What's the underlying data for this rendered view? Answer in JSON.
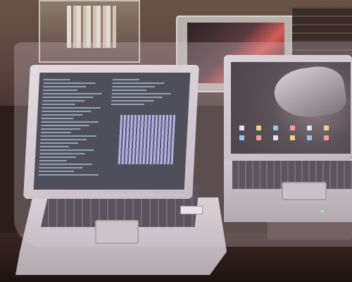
{
  "scene": {
    "subject": "",
    "colors": {
      "terminal_text": "#9fb5c6",
      "bars": "#a6a6e6",
      "led": "#7dff8a"
    }
  },
  "left_laptop": {
    "brand_badge": ""
  },
  "right_laptop": {
    "desktop_icons": 12
  }
}
